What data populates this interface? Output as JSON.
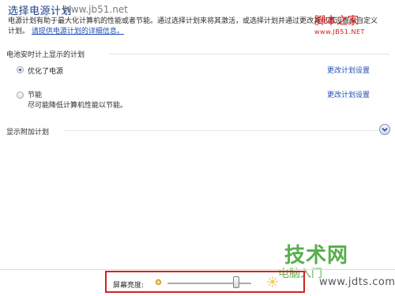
{
  "header": {
    "title": "选择电源计划",
    "site_watermark": "www.jb51.net"
  },
  "intro": {
    "text": "电源计划有助于最大化计算机的性能或者节能。通过选择计划来将其激活，或选择计划并通过更改其电源设置来自定义计划。",
    "link": "请提供电源计划的详细信息。"
  },
  "watermark_top_right": {
    "line1": "脚本之家",
    "line2": "www.JB51.NET"
  },
  "section": {
    "label": "电池安时计上显示的计划"
  },
  "plans": [
    {
      "name": "优化了电源",
      "description": "",
      "selected": true,
      "change_label": "更改计划设置"
    },
    {
      "name": "节能",
      "description": "尽可能降低计算机性能以节能。",
      "selected": false,
      "change_label": "更改计划设置"
    }
  ],
  "extra": {
    "label": "显示附加计划",
    "expand_icon": "chevron-down-icon"
  },
  "brightness": {
    "label": "屏幕亮度:",
    "value_fraction": 0.85
  },
  "watermark_bottom": {
    "line1": "技术网",
    "line2": "电脑入门",
    "line3": "www.jdts.com"
  },
  "colors": {
    "title": "#1e3e8a",
    "link": "#1f4fb3",
    "highlight_box": "#d22222",
    "watermark_green": "#3aa12c"
  }
}
